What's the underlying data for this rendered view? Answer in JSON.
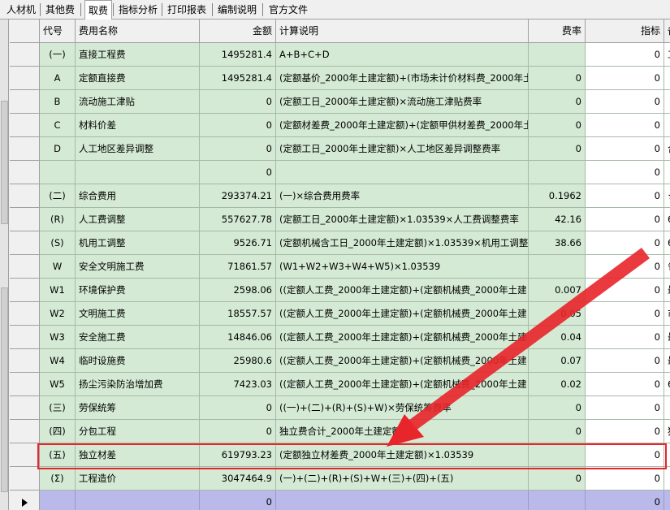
{
  "tabs": [
    {
      "label": "人材机",
      "active": false
    },
    {
      "label": "其他费",
      "active": false
    },
    {
      "label": "取费",
      "active": true
    },
    {
      "label": "指标分析",
      "active": false
    },
    {
      "label": "打印报表",
      "active": false
    },
    {
      "label": "编制说明",
      "active": false
    },
    {
      "label": "官方文件",
      "active": false
    }
  ],
  "grid": {
    "headers": {
      "code": "代号",
      "name": "费用名称",
      "amount": "金额",
      "formula": "计算说明",
      "rate": "费率",
      "index": "指标",
      "extra": "备"
    },
    "rows": [
      {
        "code": "(一)",
        "name": "直接工程费",
        "amount": "1495281.4",
        "formula": "A+B+C+D",
        "rate": "",
        "index": "0",
        "extra": "工"
      },
      {
        "code": "A",
        "name": "定额直接费",
        "amount": "1495281.4",
        "formula": "(定额基价_2000年土建定额)+(市场未计价材料费_2000年土",
        "rate": "0",
        "index": "0",
        "extra": ""
      },
      {
        "code": "B",
        "name": "流动施工津贴",
        "amount": "0",
        "formula": "(定额工日_2000年土建定额)×流动施工津贴费率",
        "rate": "0",
        "index": "0",
        "extra": ""
      },
      {
        "code": "C",
        "name": "材料价差",
        "amount": "0",
        "formula": "(定额材差费_2000年土建定额)+(定额甲供材差费_2000年土",
        "rate": "0",
        "index": "0",
        "extra": ""
      },
      {
        "code": "D",
        "name": "人工地区差异调整",
        "amount": "0",
        "formula": "(定额工日_2000年土建定额)×人工地区差异调整费率",
        "rate": "0",
        "index": "0",
        "extra": "合"
      },
      {
        "code": "",
        "name": "",
        "amount": "0",
        "formula": "",
        "rate": "",
        "index": "0",
        "extra": ""
      },
      {
        "code": "(二)",
        "name": "综合费用",
        "amount": "293374.21",
        "formula": "(一)×综合费用费率",
        "rate": "0.1962",
        "index": "0",
        "extra": "★"
      },
      {
        "code": "(R)",
        "name": "人工费调整",
        "amount": "557627.78",
        "formula": "(定额工日_2000年土建定额)×1.03539×人工费调整费率",
        "rate": "42.16",
        "index": "0",
        "extra": "6"
      },
      {
        "code": "(S)",
        "name": "机用工调整",
        "amount": "9526.71",
        "formula": "(定额机械含工日_2000年土建定额)×1.03539×机用工调整",
        "rate": "38.66",
        "index": "0",
        "extra": "6"
      },
      {
        "code": "W",
        "name": "安全文明施工费",
        "amount": "71861.57",
        "formula": "(W1+W2+W3+W4+W5)×1.03539",
        "rate": "",
        "index": "0",
        "extra": "省"
      },
      {
        "code": "W1",
        "name": "环境保护费",
        "amount": "2598.06",
        "formula": "((定额人工费_2000年土建定额)+(定额机械费_2000年土建",
        "rate": "0.007",
        "index": "0",
        "extra": "最"
      },
      {
        "code": "W2",
        "name": "文明施工费",
        "amount": "18557.57",
        "formula": "((定额人工费_2000年土建定额)+(定额机械费_2000年土建",
        "rate": "0.05",
        "index": "0",
        "extra": "市"
      },
      {
        "code": "W3",
        "name": "安全施工费",
        "amount": "14846.06",
        "formula": "((定额人工费_2000年土建定额)+(定额机械费_2000年土建",
        "rate": "0.04",
        "index": "0",
        "extra": "最"
      },
      {
        "code": "W4",
        "name": "临时设施费",
        "amount": "25980.6",
        "formula": "((定额人工费_2000年土建定额)+(定额机械费_2000年土建",
        "rate": "0.07",
        "index": "0",
        "extra": "最"
      },
      {
        "code": "W5",
        "name": "扬尘污染防治增加费",
        "amount": "7423.03",
        "formula": "((定额人工费_2000年土建定额)+(定额机械费_2000年土建",
        "rate": "0.02",
        "index": "0",
        "extra": "6"
      },
      {
        "code": "(三)",
        "name": "劳保统筹",
        "amount": "0",
        "formula": "((一)+(二)+(R)+(S)+W)×劳保统筹费率",
        "rate": "0",
        "index": "0",
        "extra": ""
      },
      {
        "code": "(四)",
        "name": "分包工程",
        "amount": "0",
        "formula": "独立费合计_2000年土建定额",
        "rate": "0",
        "index": "0",
        "extra": "独"
      },
      {
        "code": "(五)",
        "name": "独立材差",
        "amount": "619793.23",
        "formula": "(定额独立材差费_2000年土建定额)×1.03539",
        "rate": "",
        "index": "0",
        "extra": ""
      },
      {
        "code": "(Σ)",
        "name": "工程造价",
        "amount": "3047464.9",
        "formula": "(一)+(二)+(R)+(S)+W+(三)+(四)+(五)",
        "rate": "0",
        "index": "0",
        "extra": ""
      },
      {
        "code": "",
        "name": "",
        "amount": "0",
        "formula": "",
        "rate": "",
        "index": "0",
        "extra": ""
      }
    ]
  },
  "annotation": {
    "highlight_color": "#e8252a",
    "highlighted_row_code": "(五)",
    "arrow_color": "#e8252a"
  },
  "icons": [
    "row-pointer-icon"
  ]
}
